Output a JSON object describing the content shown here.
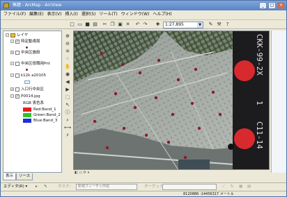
{
  "window": {
    "title": "無題 - ArcMap - ArcView"
  },
  "window_buttons": [
    "_",
    "□",
    "×"
  ],
  "menu": [
    "ファイル(F)",
    "編集(E)",
    "表示(V)",
    "挿入(I)",
    "選択(S)",
    "ツール(T)",
    "ウィンドウ(W)",
    "ヘルプ(H)"
  ],
  "toolbar": {
    "scale": "1:27,895"
  },
  "toc": {
    "root_label": "レイヤ",
    "items": [
      {
        "label": "特定動達局",
        "checked": true
      },
      {
        "label": "中央区施設",
        "checked": false
      },
      {
        "label": "中央区役職用Pnt",
        "checked": false
      },
      {
        "label": "k12k a20105",
        "checked": false
      },
      {
        "label": "入口行中央区",
        "checked": false
      },
      {
        "label": "P0014.jpg",
        "checked": true
      }
    ],
    "rgb_title": "RGB 表色系",
    "bands": [
      {
        "label": "Red:Band_1",
        "color": "#e0201a"
      },
      {
        "label": "Green:Band_2",
        "color": "#2fc42a"
      },
      {
        "label": "Blue:Band_3",
        "color": "#1d2fd8"
      }
    ],
    "tabs": [
      "表示",
      "ソース"
    ]
  },
  "map": {
    "film_labels": [
      "CKK-99-2X",
      "1",
      "C11-14"
    ],
    "marker_color": "#8b1a2b",
    "disc_color": "#d82a2e"
  },
  "editor": {
    "label": "エディタ(R) ▾",
    "task_label": "タスク:",
    "task_value": "新規フィーチャ作成",
    "target_label": "ターゲット:"
  },
  "status": {
    "coords": "8120886  -14456317 メートル"
  }
}
